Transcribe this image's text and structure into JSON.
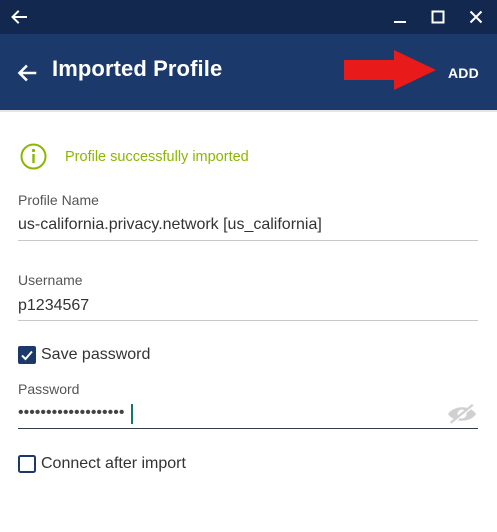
{
  "window": {
    "back_icon": "arrow-left-icon",
    "minimize_icon": "minimize-icon",
    "maximize_icon": "maximize-icon",
    "close_icon": "close-icon"
  },
  "header": {
    "title": "Imported Profile",
    "add_label": "ADD",
    "back_icon": "arrow-left-icon",
    "annotation_icon": "red-arrow-icon",
    "background": "#1b3a6b"
  },
  "status": {
    "icon": "info-circle-icon",
    "message": "Profile successfully imported",
    "color": "#8cb700"
  },
  "form": {
    "profile_name_label": "Profile Name",
    "profile_name_value": "us-california.privacy.network [us_california]",
    "username_label": "Username",
    "username_value": "p1234567",
    "save_password_label": "Save password",
    "save_password_checked": true,
    "password_label": "Password",
    "password_mask": "•••••••••••••••••••",
    "password_toggle_icon": "eye-slash-icon",
    "connect_after_import_label": "Connect after import",
    "connect_after_import_checked": false
  }
}
